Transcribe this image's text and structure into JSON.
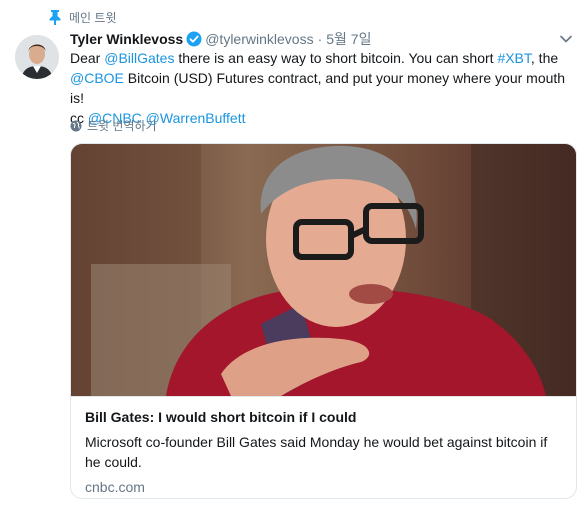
{
  "pinned": {
    "label": "메인 트윗",
    "icon": "pin-icon"
  },
  "author": {
    "name": "Tyler Winklevoss",
    "handle": "@tylerwinklevoss",
    "separator": "·",
    "date": "5월 7일",
    "verified_icon": "verified-badge-icon"
  },
  "tweet": {
    "line1_prefix": "Dear ",
    "mention_billgates": "@BillGates",
    "line1_mid": " there is an easy way to short bitcoin. You can short ",
    "hashtag_xbt": "#XBT",
    "line1_suffix": ", the",
    "mention_cboe": "@CBOE",
    "line2_mid": " Bitcoin (USD) Futures contract, and put your money where your mouth is!",
    "line3_prefix": "cc ",
    "mention_cnbc": "@CNBC",
    "mention_buffett": "@WarrenBuffett"
  },
  "translate": {
    "label": "트윗 번역하기",
    "icon": "globe-icon"
  },
  "card": {
    "title": "Bill Gates: I would short bitcoin if I could",
    "description": "Microsoft co-founder Bill Gates said Monday he would bet against bitcoin if he could.",
    "domain": "cnbc.com"
  },
  "colors": {
    "link": "#1b95e0",
    "muted": "#657786",
    "text": "#14171a",
    "pin": "#1da1f2"
  }
}
